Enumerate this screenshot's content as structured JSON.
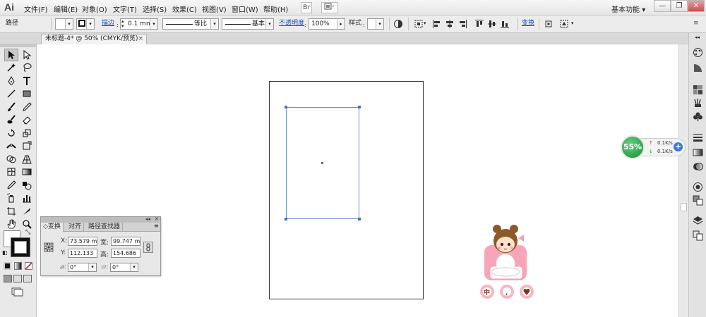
{
  "app": {
    "logo": "Ai",
    "workspace": "基本功能",
    "workspace_arrow": "▾"
  },
  "menu": [
    "文件(F)",
    "编辑(E)",
    "对象(O)",
    "文字(T)",
    "选择(S)",
    "效果(C)",
    "视图(V)",
    "窗口(W)",
    "帮助(H)"
  ],
  "menu_buttons": {
    "bridge": "Br"
  },
  "window_controls": {
    "min": "—",
    "max": "❐",
    "close": "✕"
  },
  "control_bar": {
    "selection_label": "路径",
    "stroke_link": "描边",
    "stroke_weight": "0.1 mm",
    "profile_label": "等比",
    "brush_label": "基本",
    "opacity_link": "不透明度",
    "opacity_value": "100%",
    "style_label": "样式",
    "transform_link": "变换"
  },
  "document_tab": {
    "title": "未标题-4* @ 50% (CMYK/预览)",
    "close": "×"
  },
  "transform_panel": {
    "tabs": [
      "变换",
      "对齐",
      "路径查找器"
    ],
    "x_label": "X:",
    "x_value": "73.579 m",
    "w_label": "宽:",
    "w_value": "99.747 m",
    "y_label": "Y:",
    "y_value": "112.133",
    "h_label": "高:",
    "h_value": "154.686",
    "rotate_value": "0°",
    "shear_value": "0°",
    "collapse": "◂◂",
    "close": "✕"
  },
  "speed_widget": {
    "percent": "55%",
    "upload": "0.1K/s",
    "download": "0.1K/s",
    "plus": "+"
  },
  "colors": {
    "selection": "#4a6fb8",
    "link": "#1a4fb8",
    "speed_green": "#1f8c3c"
  }
}
